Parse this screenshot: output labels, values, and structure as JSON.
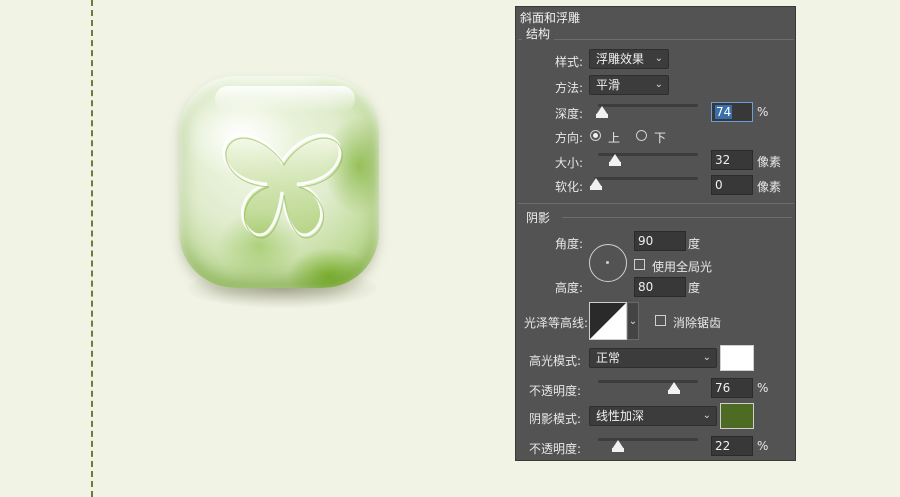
{
  "panel": {
    "title": "斜面和浮雕",
    "structure": {
      "label": "结构",
      "style_label": "样式:",
      "style_value": "浮雕效果",
      "technique_label": "方法:",
      "technique_value": "平滑",
      "depth_label": "深度:",
      "depth_value": "74",
      "depth_unit": "%",
      "depth_level": 0.04,
      "direction_label": "方向:",
      "direction_up": "上",
      "direction_down": "下",
      "direction_selected": "上",
      "size_label": "大小:",
      "size_value": "32",
      "size_unit": "像素",
      "size_level": 0.17,
      "soften_label": "软化:",
      "soften_value": "0",
      "soften_unit": "像素",
      "soften_level": 0.0
    },
    "shading": {
      "label": "阴影",
      "angle_label": "角度:",
      "angle_value": "90",
      "angle_unit": "度",
      "global_light_label": "使用全局光",
      "global_light_checked": false,
      "altitude_label": "高度:",
      "altitude_value": "80",
      "altitude_unit": "度",
      "gloss_contour_label": "光泽等高线:",
      "anti_aliased_label": "消除锯齿",
      "anti_aliased_checked": false,
      "highlight_mode_label": "高光模式:",
      "highlight_mode_value": "正常",
      "highlight_color": "#ffffff",
      "highlight_opacity_label": "不透明度:",
      "highlight_opacity_value": "76",
      "highlight_opacity_unit": "%",
      "shadow_mode_label": "阴影模式:",
      "shadow_mode_value": "线性加深",
      "shadow_color": "#4e6b23",
      "shadow_opacity_label": "不透明度:",
      "shadow_opacity_value": "22",
      "shadow_opacity_unit": "%"
    }
  },
  "icons": {
    "dropdown": "chevron-down-icon",
    "jade": "butterfly-icon"
  },
  "colors": {
    "canvas_bg": "#f1f3e5",
    "panel_bg": "#535353",
    "guide_line": "#6f7a3d"
  }
}
